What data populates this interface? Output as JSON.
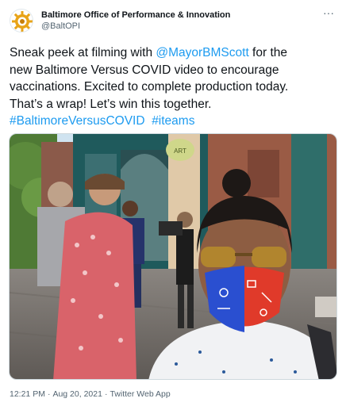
{
  "author": {
    "display_name": "Baltimore Office of Performance & Innovation",
    "handle": "@BaltOPI",
    "avatar_icon": "gear-sun-logo-icon"
  },
  "menu": {
    "more_label": "···"
  },
  "tweet": {
    "line1_before": "Sneak peek at filming with ",
    "mention": "@MayorBMScott",
    "line1_after": " for the",
    "line2": "new Baltimore Versus COVID video to encourage",
    "line3": "vaccinations. Excited to complete production today.",
    "line4": "That’s a wrap! Let’s win this together.",
    "hashtag1": "#BaltimoreVersusCOVID",
    "hashtag2": "#iteams"
  },
  "media": {
    "icon": "photo-icon",
    "sign_text": "ART"
  },
  "meta": {
    "time": "12:21 PM",
    "separator": "·",
    "date": "Aug 20, 2021",
    "source": "Twitter Web App"
  },
  "colors": {
    "link": "#1d9bf0",
    "text": "#0f1419",
    "muted": "#536471"
  }
}
